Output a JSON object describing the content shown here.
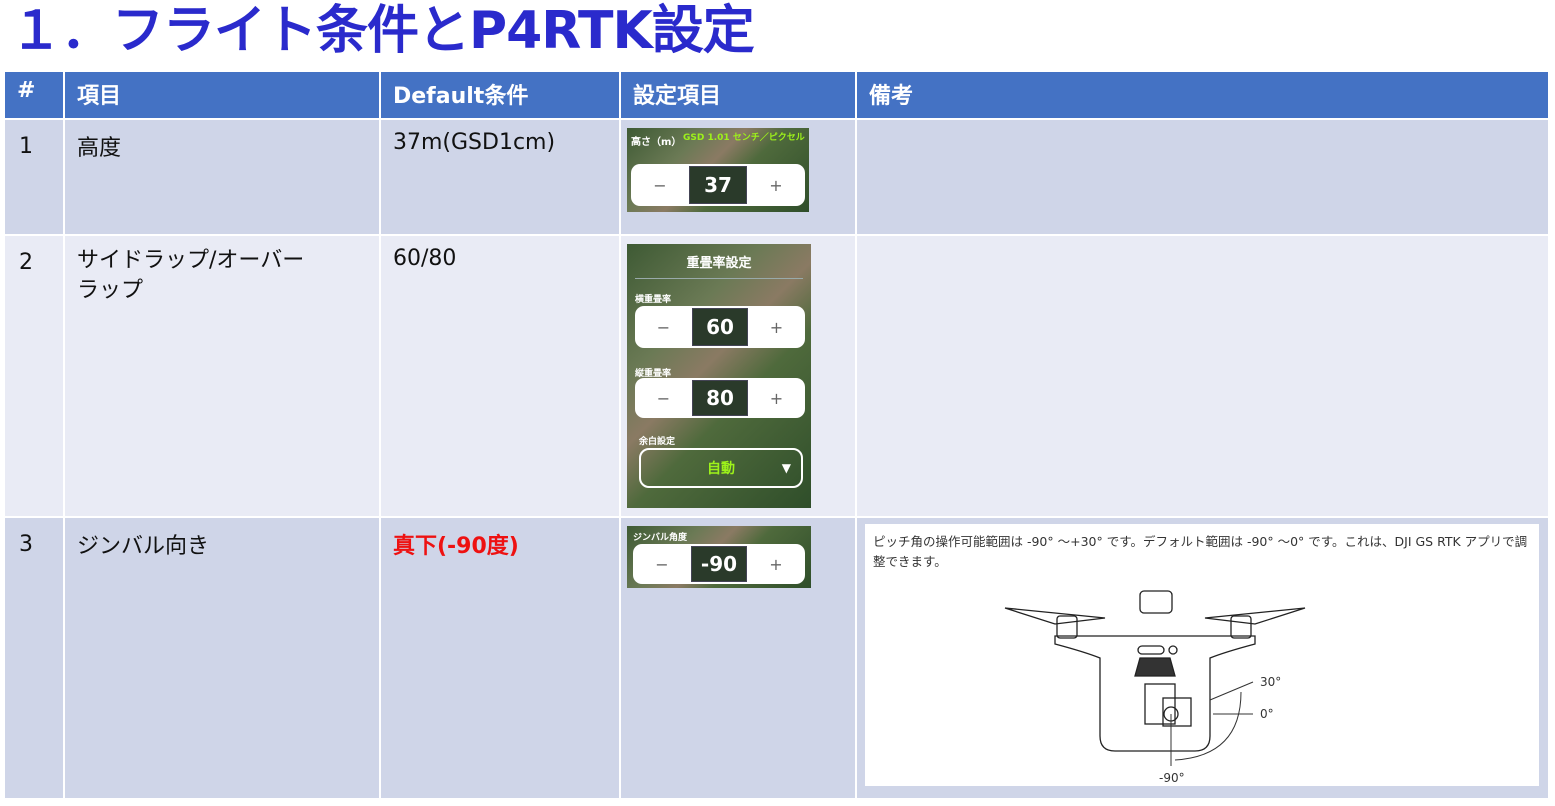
{
  "title": "１．フライト条件とP4RTK設定",
  "table": {
    "headers": [
      "#",
      "項目",
      "Default条件",
      "設定項目",
      "備考"
    ],
    "rows": [
      {
        "num": "1",
        "item": "高度",
        "default": "37m(GSD1cm)",
        "note": ""
      },
      {
        "num": "2",
        "item": "サイドラップ/オーバーラップ",
        "default": "60/80",
        "note": ""
      },
      {
        "num": "3",
        "item": "ジンバル向き",
        "default": "真下(-90度)",
        "note": "ピッチ角の操作可能範囲は -90° ～+30° です。デフォルト範囲は -90° ～0° です。これは、DJI GS RTK アプリで調整できます。"
      }
    ]
  },
  "altitude_panel": {
    "label": "高さ（m）",
    "gsd": "GSD 1.01 センチ／ピクセル",
    "minus": "−",
    "value": "37",
    "plus": "+"
  },
  "overlap_panel": {
    "title": "重畳率設定",
    "side_label": "横重畳率",
    "side_value": "60",
    "front_label": "縦重畳率",
    "front_value": "80",
    "margin_label": "余白設定",
    "margin_value": "自動",
    "minus": "−",
    "plus": "+",
    "arrow": "▼"
  },
  "gimbal_panel": {
    "label": "ジンバル角度",
    "minus": "−",
    "value": "-90",
    "plus": "+"
  },
  "diagram": {
    "angle_labels": [
      "30°",
      "0°",
      "-90°"
    ]
  },
  "colors": {
    "title": "#2a2acc",
    "header_bg": "#4472c4",
    "row_odd": "#cfd5e8",
    "row_even": "#e9ebf5",
    "highlight": "#ee1111",
    "app_accent": "#9df21a"
  }
}
